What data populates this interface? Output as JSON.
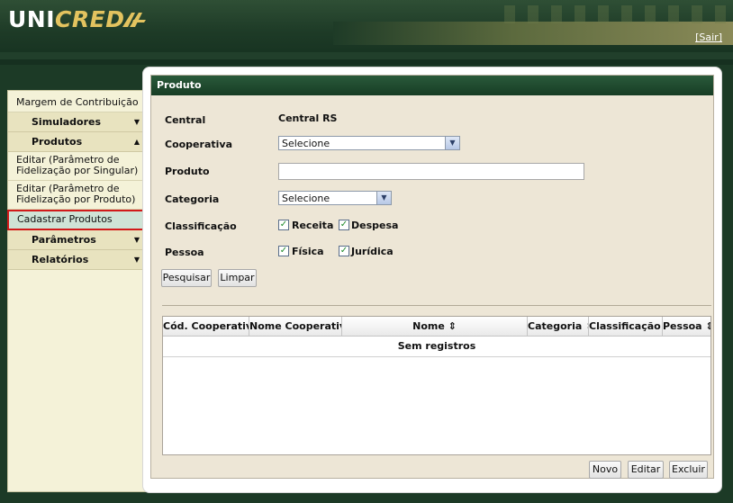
{
  "header": {
    "logo_part1": "UNI",
    "logo_part2": "CRED",
    "logout_link": "[Sair]"
  },
  "sidebar": {
    "top_item": "Margem de Contribuição",
    "sections": [
      {
        "label": "Simuladores",
        "arrow": "▼"
      },
      {
        "label": "Produtos",
        "arrow": "▲"
      }
    ],
    "product_items": [
      "Editar (Parâmetro de Fidelização por Singular)",
      "Editar (Parâmetro de Fidelização por Produto)",
      "Cadastrar Produtos"
    ],
    "more_sections": [
      {
        "label": "Parâmetros",
        "arrow": "▼"
      },
      {
        "label": "Relatórios",
        "arrow": "▼"
      }
    ]
  },
  "panel": {
    "title": "Produto",
    "form": {
      "central_label": "Central",
      "central_value": "Central RS",
      "cooperativa_label": "Cooperativa",
      "cooperativa_selected": "Selecione",
      "produto_label": "Produto",
      "produto_value": "",
      "categoria_label": "Categoria",
      "categoria_selected": "Selecione",
      "classificacao_label": "Classificação",
      "receita_label": "Receita",
      "despesa_label": "Despesa",
      "pessoa_label": "Pessoa",
      "fisica_label": "Física",
      "juridica_label": "Jurídica"
    },
    "buttons": {
      "search": "Pesquisar",
      "clear": "Limpar",
      "new": "Novo",
      "edit": "Editar",
      "delete": "Excluir"
    },
    "table": {
      "columns": [
        "Cód. Cooperativa",
        "Nome Cooperativa",
        "Nome ⇕",
        "Categoria ⇕",
        "Classificação ⇕",
        "Pessoa ⇕"
      ],
      "empty_message": "Sem registros"
    }
  },
  "colors": {
    "header_green": "#1e3b27",
    "panel_title_green": "#173d25",
    "sidebar_bg": "#f4f2d8",
    "active_border": "#d21a1a",
    "checkbox_check": "#1f8a2a"
  }
}
